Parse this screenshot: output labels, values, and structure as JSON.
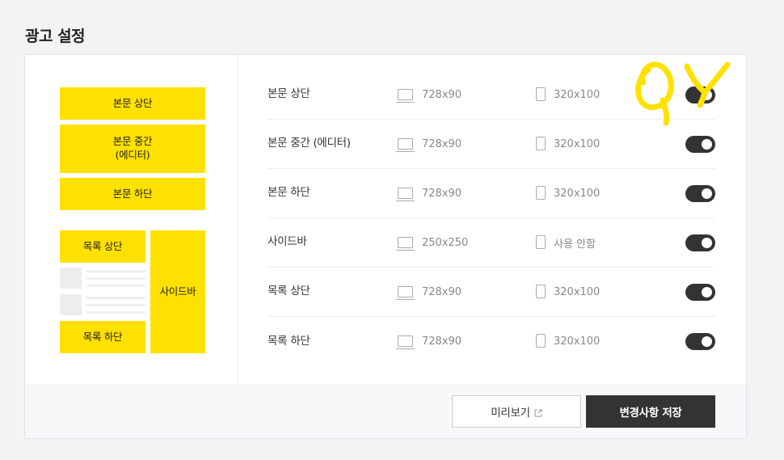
{
  "page": {
    "title": "광고 설정"
  },
  "preview": {
    "blocks": {
      "body_top": "본문 상단",
      "body_mid": "본문 중간\n(에디터)",
      "body_bottom": "본문 하단",
      "list_top": "목록 상단",
      "list_bottom": "목록 하단",
      "sidebar": "사이드바"
    },
    "block_color": "#ffe100"
  },
  "settings": {
    "rows": [
      {
        "label": "본문 상단",
        "pc_size": "728x90",
        "mobile_size": "320x100",
        "enabled": true
      },
      {
        "label": "본문 중간 (에디터)",
        "pc_size": "728x90",
        "mobile_size": "320x100",
        "enabled": true
      },
      {
        "label": "본문 하단",
        "pc_size": "728x90",
        "mobile_size": "320x100",
        "enabled": true
      },
      {
        "label": "사이드바",
        "pc_size": "250x250",
        "mobile_size": "사용 안함",
        "enabled": true
      },
      {
        "label": "목록 상단",
        "pc_size": "728x90",
        "mobile_size": "320x100",
        "enabled": true
      },
      {
        "label": "목록 하단",
        "pc_size": "728x90",
        "mobile_size": "320x100",
        "enabled": true
      }
    ]
  },
  "footer": {
    "preview_label": "미리보기",
    "save_label": "변경사항 저장"
  },
  "colors": {
    "accent": "#ffe100",
    "toggle_on": "#333333",
    "save_button": "#333333"
  }
}
